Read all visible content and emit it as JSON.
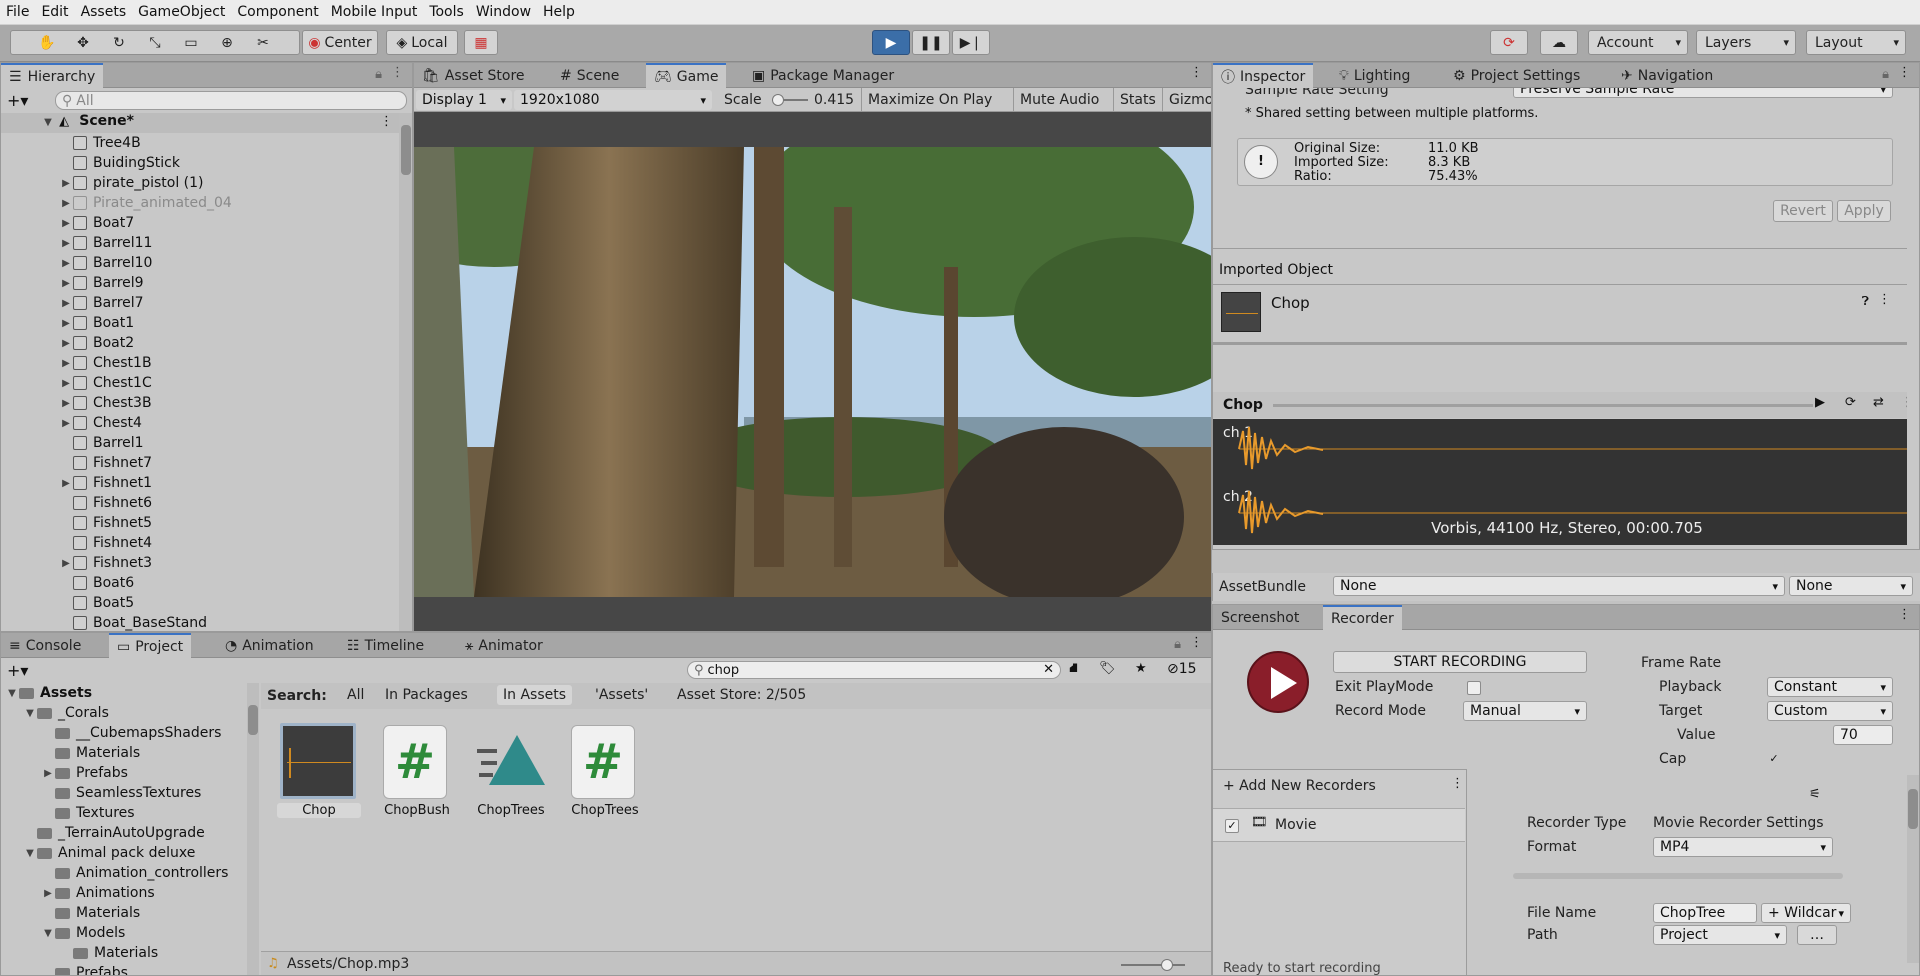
{
  "menu": [
    "File",
    "Edit",
    "Assets",
    "GameObject",
    "Component",
    "Mobile Input",
    "Tools",
    "Window",
    "Help"
  ],
  "toolbar": {
    "pivot_label": "Center",
    "space_label": "Local",
    "account_label": "Account",
    "layers_label": "Layers",
    "layout_label": "Layout"
  },
  "hierarchy": {
    "tab": "Hierarchy",
    "search_placeholder": "All",
    "scene": "Scene*",
    "items": [
      {
        "name": "Tree4B",
        "arrow": false,
        "dim": false
      },
      {
        "name": "BuidingStick",
        "arrow": false,
        "dim": false
      },
      {
        "name": "pirate_pistol (1)",
        "arrow": true,
        "dim": false
      },
      {
        "name": "Pirate_animated_04",
        "arrow": true,
        "dim": true
      },
      {
        "name": "Boat7",
        "arrow": true,
        "dim": false
      },
      {
        "name": "Barrel11",
        "arrow": true,
        "dim": false
      },
      {
        "name": "Barrel10",
        "arrow": true,
        "dim": false
      },
      {
        "name": "Barrel9",
        "arrow": true,
        "dim": false
      },
      {
        "name": "Barrel7",
        "arrow": true,
        "dim": false
      },
      {
        "name": "Boat1",
        "arrow": true,
        "dim": false
      },
      {
        "name": "Boat2",
        "arrow": true,
        "dim": false
      },
      {
        "name": "Chest1B",
        "arrow": true,
        "dim": false
      },
      {
        "name": "Chest1C",
        "arrow": true,
        "dim": false
      },
      {
        "name": "Chest3B",
        "arrow": true,
        "dim": false
      },
      {
        "name": "Chest4",
        "arrow": true,
        "dim": false
      },
      {
        "name": "Barrel1",
        "arrow": false,
        "dim": false
      },
      {
        "name": "Fishnet7",
        "arrow": false,
        "dim": false
      },
      {
        "name": "Fishnet1",
        "arrow": true,
        "dim": false
      },
      {
        "name": "Fishnet6",
        "arrow": false,
        "dim": false
      },
      {
        "name": "Fishnet5",
        "arrow": false,
        "dim": false
      },
      {
        "name": "Fishnet4",
        "arrow": false,
        "dim": false
      },
      {
        "name": "Fishnet3",
        "arrow": true,
        "dim": false
      },
      {
        "name": "Boat6",
        "arrow": false,
        "dim": false
      },
      {
        "name": "Boat5",
        "arrow": false,
        "dim": false
      },
      {
        "name": "Boat_BaseStand",
        "arrow": false,
        "dim": false
      }
    ]
  },
  "game": {
    "tabs": [
      "Asset Store",
      "Scene",
      "Game",
      "Package Manager"
    ],
    "display": "Display 1",
    "resolution": "1920x1080",
    "scale_label": "Scale",
    "scale_value": "0.415",
    "maximize": "Maximize On Play",
    "mute": "Mute Audio",
    "stats": "Stats",
    "gizmos": "Gizmos"
  },
  "inspector": {
    "tabs": [
      "Inspector",
      "Lighting",
      "Project Settings",
      "Navigation"
    ],
    "sample_rate_label": "Sample Rate Setting",
    "sample_rate_value": "Preserve Sample Rate",
    "shared_note": "* Shared setting between multiple platforms.",
    "original_size_label": "Original Size:",
    "original_size": "11.0 KB",
    "imported_size_label": "Imported Size:",
    "imported_size": "8.3 KB",
    "ratio_label": "Ratio:",
    "ratio": "75.43%",
    "revert": "Revert",
    "apply": "Apply",
    "imported_object": "Imported Object",
    "object_name": "Chop",
    "preview_title": "Chop",
    "ch1": "ch 1",
    "ch2": "ch 2",
    "audio_info": "Vorbis, 44100 Hz, Stereo, 00:00.705",
    "assetbundle_label": "AssetBundle",
    "assetbundle_value": "None",
    "assetbundle_variant": "None"
  },
  "recorder": {
    "tabs": [
      "Screenshot",
      "Recorder"
    ],
    "start": "START RECORDING",
    "exit_playmode": "Exit PlayMode",
    "record_mode_label": "Record Mode",
    "record_mode": "Manual",
    "frame_rate": "Frame Rate",
    "playback_label": "Playback",
    "playback": "Constant",
    "target_label": "Target",
    "target": "Custom",
    "value_label": "Value",
    "value": "70",
    "cap_label": "Cap",
    "add_new": "+ Add New Recorders",
    "movie": "Movie",
    "recorder_type_label": "Recorder Type",
    "recorder_type": "Movie Recorder Settings",
    "format_label": "Format",
    "format": "MP4",
    "file_name_label": "File Name",
    "file_name": "ChopTree",
    "wildcard": "+ Wildcar",
    "path_label": "Path",
    "path": "Project",
    "status": "Ready to start recording"
  },
  "project": {
    "tabs": [
      "Console",
      "Project",
      "Animation",
      "Timeline",
      "Animator"
    ],
    "search_value": "chop",
    "filter_count": "15",
    "search_label": "Search:",
    "filters": [
      "All",
      "In Packages",
      "In Assets",
      "'Assets'",
      "Asset Store: 2/505"
    ],
    "tree": [
      {
        "name": "Assets",
        "depth": 0,
        "arrow": "▼",
        "bold": true
      },
      {
        "name": "_Corals",
        "depth": 1,
        "arrow": "▼",
        "bold": false
      },
      {
        "name": "__CubemapsShaders",
        "depth": 2,
        "arrow": "",
        "bold": false
      },
      {
        "name": "Materials",
        "depth": 2,
        "arrow": "",
        "bold": false
      },
      {
        "name": "Prefabs",
        "depth": 2,
        "arrow": "▶",
        "bold": false
      },
      {
        "name": "SeamlessTextures",
        "depth": 2,
        "arrow": "",
        "bold": false
      },
      {
        "name": "Textures",
        "depth": 2,
        "arrow": "",
        "bold": false
      },
      {
        "name": "_TerrainAutoUpgrade",
        "depth": 1,
        "arrow": "",
        "bold": false
      },
      {
        "name": "Animal pack deluxe",
        "depth": 1,
        "arrow": "▼",
        "bold": false
      },
      {
        "name": "Animation_controllers",
        "depth": 2,
        "arrow": "",
        "bold": false
      },
      {
        "name": "Animations",
        "depth": 2,
        "arrow": "▶",
        "bold": false
      },
      {
        "name": "Materials",
        "depth": 2,
        "arrow": "",
        "bold": false
      },
      {
        "name": "Models",
        "depth": 2,
        "arrow": "▼",
        "bold": false
      },
      {
        "name": "Materials",
        "depth": 3,
        "arrow": "",
        "bold": false
      },
      {
        "name": "Prefabs",
        "depth": 2,
        "arrow": "",
        "bold": false
      }
    ],
    "assets": [
      {
        "name": "Chop",
        "kind": "audio"
      },
      {
        "name": "ChopBush",
        "kind": "script"
      },
      {
        "name": "ChopTrees",
        "kind": "tree"
      },
      {
        "name": "ChopTrees",
        "kind": "script"
      }
    ],
    "footer_path": "Assets/Chop.mp3"
  }
}
